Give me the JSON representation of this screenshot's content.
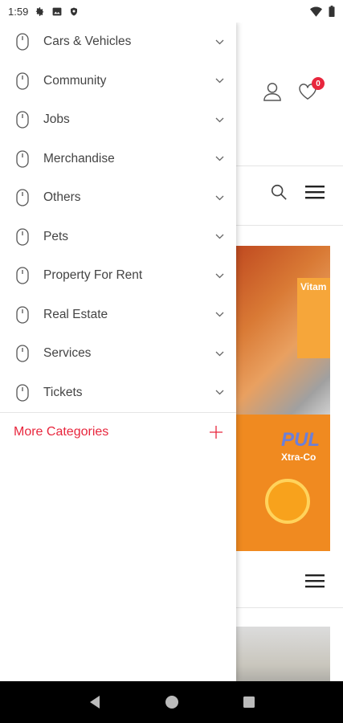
{
  "status_bar": {
    "time": "1:59"
  },
  "drawer": {
    "categories": [
      {
        "label": "Cars & Vehicles"
      },
      {
        "label": "Community"
      },
      {
        "label": "Jobs"
      },
      {
        "label": "Merchandise"
      },
      {
        "label": "Others"
      },
      {
        "label": "Pets"
      },
      {
        "label": "Property For Rent"
      },
      {
        "label": "Real Estate"
      },
      {
        "label": "Services"
      },
      {
        "label": "Tickets"
      }
    ],
    "more_categories_label": "More Categories"
  },
  "background": {
    "wishlist_count": "0",
    "banner": {
      "vitam_text": "Vitam",
      "pul_text": "PUL",
      "xtra_text": "Xtra-Co"
    }
  },
  "colors": {
    "accent": "#e8263d",
    "text": "#444444",
    "divider": "#e5e5e5",
    "navbar": "#000000"
  }
}
